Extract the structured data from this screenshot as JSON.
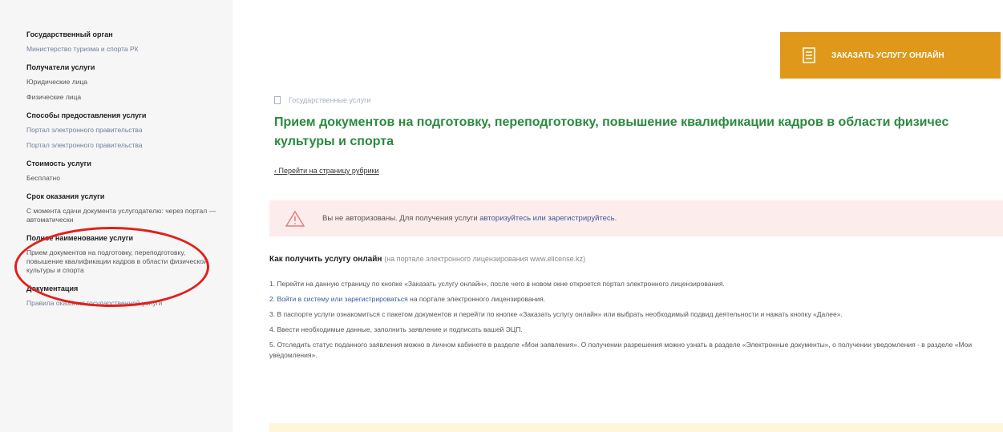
{
  "sidebar": {
    "org_heading": "Государственный орган",
    "org_value": "Министерство туризма и спорта РК",
    "recipients_heading": "Получатели услуги",
    "recipients": [
      "Юридические лица",
      "Физические лица"
    ],
    "methods_heading": "Способы предоставления услуги",
    "methods": [
      "Портал электронного правительства",
      "Портал электронного правительства"
    ],
    "cost_heading": "Стоимость услуги",
    "cost_value": "Бесплатно",
    "term_heading": "Срок оказания услуги",
    "term_value": "С момента сдачи документа услугодателю: через портал — автоматически",
    "fullname_heading": "Полное наименование услуги",
    "fullname_value": "Прием документов на подготовку, переподготовку, повышение квалификации кадров в области физической культуры и спорта",
    "docs_heading": "Документация",
    "docs_value": "Правила оказания государственной услуги"
  },
  "header": {
    "order_button_label": "ЗАКАЗАТЬ УСЛУГУ ОНЛАЙН"
  },
  "main": {
    "breadcrumb": "Государственные услуги",
    "title_line1": "Прием документов на подготовку, переподготовку, повышение квалификации кадров в области физичес",
    "title_line2": "культуры и спорта",
    "back_link": "‹ Перейти на страницу рубрики",
    "alert_text": "Вы не авторизованы. Для получения услуги ",
    "alert_link": "авторизуйтесь или зарегистрируйтесь.",
    "how_title": "Как получить услугу онлайн",
    "how_paren": "(на портале электронного лицензирования www.elicense.kz)",
    "steps": [
      {
        "text": "1. Перейти на данную страницу по кнопке «Заказать услугу онлайн», после чего в новом окне откроется портал электронного лицензирования.",
        "link": ""
      },
      {
        "link": "2. Войти в систему или зарегистрироваться",
        "text": " на портале электронного лицензирования."
      },
      {
        "text": "3. В паспорте услуги ознакомиться с пакетом документов и перейти по кнопке «Заказать услугу онлайн» или выбрать необходимый подвид деятельности и нажать кнопку «Далее».",
        "link": ""
      },
      {
        "text": "4. Ввести необходимые данные, заполнить заявление и подписать вашей ЭЦП.",
        "link": ""
      },
      {
        "text": "5. Отследить статус поданного заявления можно в личном кабинете в разделе «Мои заявления». О получении разрешения можно узнать в разделе «Электронные документы», о получении уведомления - в разделе «Мои уведомления».",
        "link": ""
      }
    ]
  }
}
